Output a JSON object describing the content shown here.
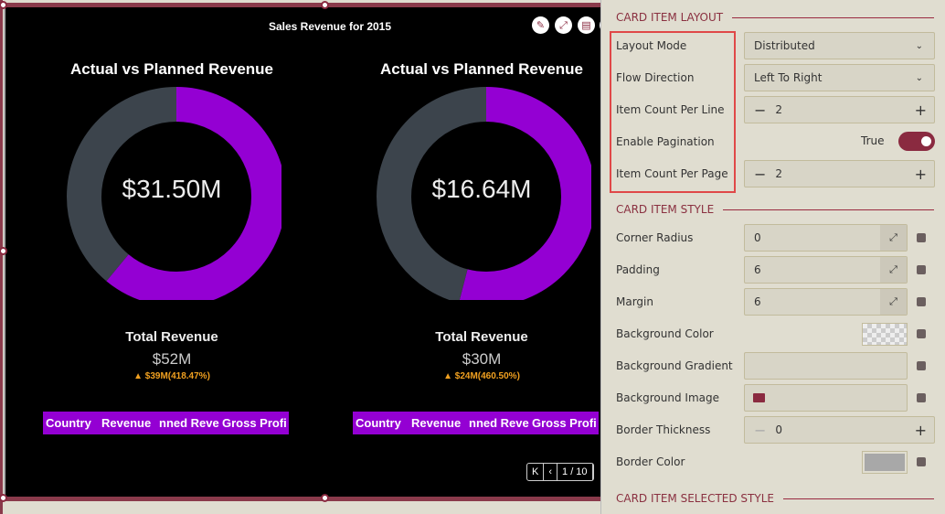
{
  "widget": {
    "title": "Sales Revenue for 2015",
    "toolbar": [
      "pencil-icon",
      "expand-icon",
      "comment-icon"
    ],
    "cards": [
      {
        "heading": "Actual vs Planned Revenue",
        "center_value": "$31.50M",
        "actual_fraction": 0.61,
        "total_label": "Total Revenue",
        "total_value": "$52M",
        "delta": "▲ $39M(418.47%)",
        "columns": [
          "Country",
          "Revenue",
          "nned Reve",
          "Gross Profi"
        ]
      },
      {
        "heading": "Actual vs Planned Revenue",
        "center_value": "$16.64M",
        "actual_fraction": 0.54,
        "total_label": "Total Revenue",
        "total_value": "$30M",
        "delta": "▲ $24M(460.50%)",
        "columns": [
          "Country",
          "Revenue",
          "nned Reve",
          "Gross Profi"
        ]
      }
    ],
    "colors": {
      "actual": "#9400d3",
      "planned": "#3c444c",
      "delta": "#f0a020"
    },
    "pager": {
      "first": "K",
      "prev": "‹",
      "page": "1 / 10"
    }
  },
  "panel": {
    "layout_section": "CARD ITEM LAYOUT",
    "layout_mode": {
      "label": "Layout Mode",
      "value": "Distributed"
    },
    "flow_direction": {
      "label": "Flow Direction",
      "value": "Left To Right"
    },
    "item_count_line": {
      "label": "Item Count Per Line",
      "value": "2"
    },
    "enable_pagination": {
      "label": "Enable Pagination",
      "value": "True"
    },
    "item_count_page": {
      "label": "Item Count Per Page",
      "value": "2"
    },
    "style_section": "CARD ITEM STYLE",
    "corner_radius": {
      "label": "Corner Radius",
      "value": "0"
    },
    "padding": {
      "label": "Padding",
      "value": "6"
    },
    "margin": {
      "label": "Margin",
      "value": "6"
    },
    "background_color": {
      "label": "Background Color"
    },
    "background_gradient": {
      "label": "Background Gradient"
    },
    "background_image": {
      "label": "Background Image"
    },
    "border_thickness": {
      "label": "Border Thickness",
      "value": "0"
    },
    "border_color": {
      "label": "Border Color",
      "value": "#a8a8a8"
    },
    "selected_section": "CARD ITEM SELECTED STYLE",
    "accent": "#8a2a40"
  }
}
